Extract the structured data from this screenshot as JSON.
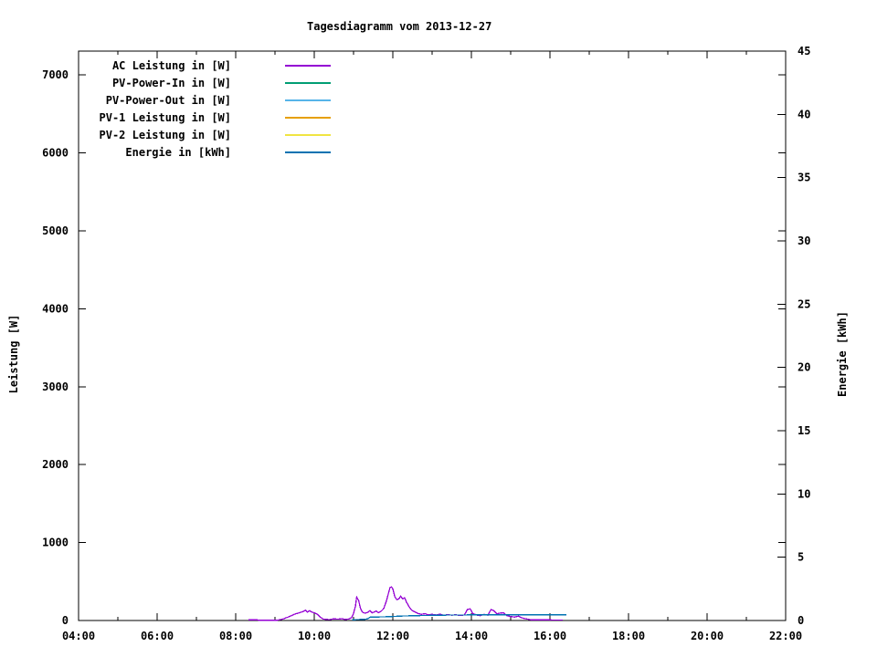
{
  "chart_data": {
    "type": "line",
    "title": "Tagesdiagramm vom 2013-12-27",
    "grid": false,
    "legend_position": "top-left",
    "x_range": [
      4,
      22
    ],
    "x_tick_hours": [
      4,
      6,
      8,
      10,
      12,
      14,
      16,
      18,
      20,
      22
    ],
    "x_tick_labels": [
      "04:00",
      "06:00",
      "08:00",
      "10:00",
      "12:00",
      "14:00",
      "16:00",
      "18:00",
      "20:00",
      "22:00"
    ],
    "x_minor_hours": [
      5,
      7,
      9,
      11,
      13,
      15,
      17,
      19,
      21
    ],
    "y_left": {
      "label": "Leistung [W]",
      "range": [
        0,
        7307
      ],
      "tick_values": [
        0,
        1000,
        2000,
        3000,
        4000,
        5000,
        6000,
        7000
      ],
      "tick_labels": [
        "0",
        "1000",
        "2000",
        "3000",
        "4000",
        "5000",
        "6000",
        "7000"
      ]
    },
    "y_right": {
      "label": "Energie [kWh]",
      "range": [
        0,
        45
      ],
      "tick_values": [
        0,
        5,
        10,
        15,
        20,
        25,
        30,
        35,
        40,
        45
      ],
      "tick_labels": [
        "0",
        "5",
        "10",
        "15",
        "20",
        "25",
        "30",
        "35",
        "40",
        "45"
      ]
    },
    "series": [
      {
        "name": "AC Leistung in [W]",
        "color": "#9400d3",
        "axis": "left",
        "points": [
          [
            8.33,
            8
          ],
          [
            8.55,
            8
          ],
          [
            8.58,
            2
          ],
          [
            9.05,
            2
          ],
          [
            9.12,
            10
          ],
          [
            9.2,
            18
          ],
          [
            9.3,
            38
          ],
          [
            9.42,
            62
          ],
          [
            9.5,
            82
          ],
          [
            9.6,
            95
          ],
          [
            9.7,
            112
          ],
          [
            9.78,
            132
          ],
          [
            9.83,
            108
          ],
          [
            9.88,
            126
          ],
          [
            9.93,
            110
          ],
          [
            10.0,
            98
          ],
          [
            10.08,
            78
          ],
          [
            10.15,
            45
          ],
          [
            10.22,
            20
          ],
          [
            10.3,
            14
          ],
          [
            10.4,
            12
          ],
          [
            10.5,
            22
          ],
          [
            10.6,
            16
          ],
          [
            10.7,
            24
          ],
          [
            10.78,
            14
          ],
          [
            10.87,
            18
          ],
          [
            10.95,
            35
          ],
          [
            11.0,
            90
          ],
          [
            11.05,
            190
          ],
          [
            11.08,
            300
          ],
          [
            11.13,
            255
          ],
          [
            11.18,
            150
          ],
          [
            11.23,
            105
          ],
          [
            11.3,
            92
          ],
          [
            11.37,
            108
          ],
          [
            11.42,
            128
          ],
          [
            11.47,
            98
          ],
          [
            11.53,
            110
          ],
          [
            11.58,
            122
          ],
          [
            11.63,
            100
          ],
          [
            11.7,
            118
          ],
          [
            11.77,
            155
          ],
          [
            11.83,
            240
          ],
          [
            11.88,
            330
          ],
          [
            11.93,
            425
          ],
          [
            11.97,
            430
          ],
          [
            12.0,
            405
          ],
          [
            12.05,
            305
          ],
          [
            12.1,
            268
          ],
          [
            12.15,
            275
          ],
          [
            12.2,
            312
          ],
          [
            12.25,
            278
          ],
          [
            12.3,
            292
          ],
          [
            12.35,
            235
          ],
          [
            12.42,
            172
          ],
          [
            12.48,
            132
          ],
          [
            12.55,
            112
          ],
          [
            12.63,
            92
          ],
          [
            12.72,
            78
          ],
          [
            12.82,
            88
          ],
          [
            12.9,
            72
          ],
          [
            13.0,
            80
          ],
          [
            13.1,
            70
          ],
          [
            13.2,
            82
          ],
          [
            13.3,
            66
          ],
          [
            13.4,
            76
          ],
          [
            13.5,
            68
          ],
          [
            13.6,
            74
          ],
          [
            13.7,
            64
          ],
          [
            13.82,
            70
          ],
          [
            13.9,
            142
          ],
          [
            13.97,
            150
          ],
          [
            14.03,
            92
          ],
          [
            14.12,
            72
          ],
          [
            14.22,
            62
          ],
          [
            14.32,
            78
          ],
          [
            14.42,
            68
          ],
          [
            14.5,
            142
          ],
          [
            14.57,
            125
          ],
          [
            14.65,
            85
          ],
          [
            14.73,
            95
          ],
          [
            14.82,
            100
          ],
          [
            14.9,
            62
          ],
          [
            15.0,
            52
          ],
          [
            15.1,
            45
          ],
          [
            15.2,
            55
          ],
          [
            15.3,
            32
          ],
          [
            15.4,
            20
          ],
          [
            15.5,
            10
          ],
          [
            15.6,
            7
          ],
          [
            15.72,
            9
          ],
          [
            15.85,
            7
          ],
          [
            16.0,
            8
          ],
          [
            16.1,
            5
          ],
          [
            16.22,
            7
          ],
          [
            16.33,
            5
          ]
        ]
      },
      {
        "name": "PV-Power-In in [W]",
        "color": "#009e73",
        "axis": "left",
        "points": []
      },
      {
        "name": "PV-Power-Out in [W]",
        "color": "#56b4e9",
        "axis": "left",
        "points": []
      },
      {
        "name": "PV-1 Leistung in [W]",
        "color": "#e69f00",
        "axis": "left",
        "points": []
      },
      {
        "name": "PV-2 Leistung in [W]",
        "color": "#f0e442",
        "axis": "left",
        "points": []
      },
      {
        "name": "Energie in [kWh]",
        "color": "#0072b2",
        "axis": "right",
        "points": [
          [
            10.97,
            0.05
          ],
          [
            11.3,
            0.1
          ],
          [
            11.35,
            0.12
          ],
          [
            11.42,
            0.26
          ],
          [
            11.9,
            0.3
          ],
          [
            12.3,
            0.36
          ],
          [
            12.8,
            0.4
          ],
          [
            13.5,
            0.43
          ],
          [
            14.3,
            0.45
          ],
          [
            16.42,
            0.45
          ]
        ]
      }
    ]
  }
}
